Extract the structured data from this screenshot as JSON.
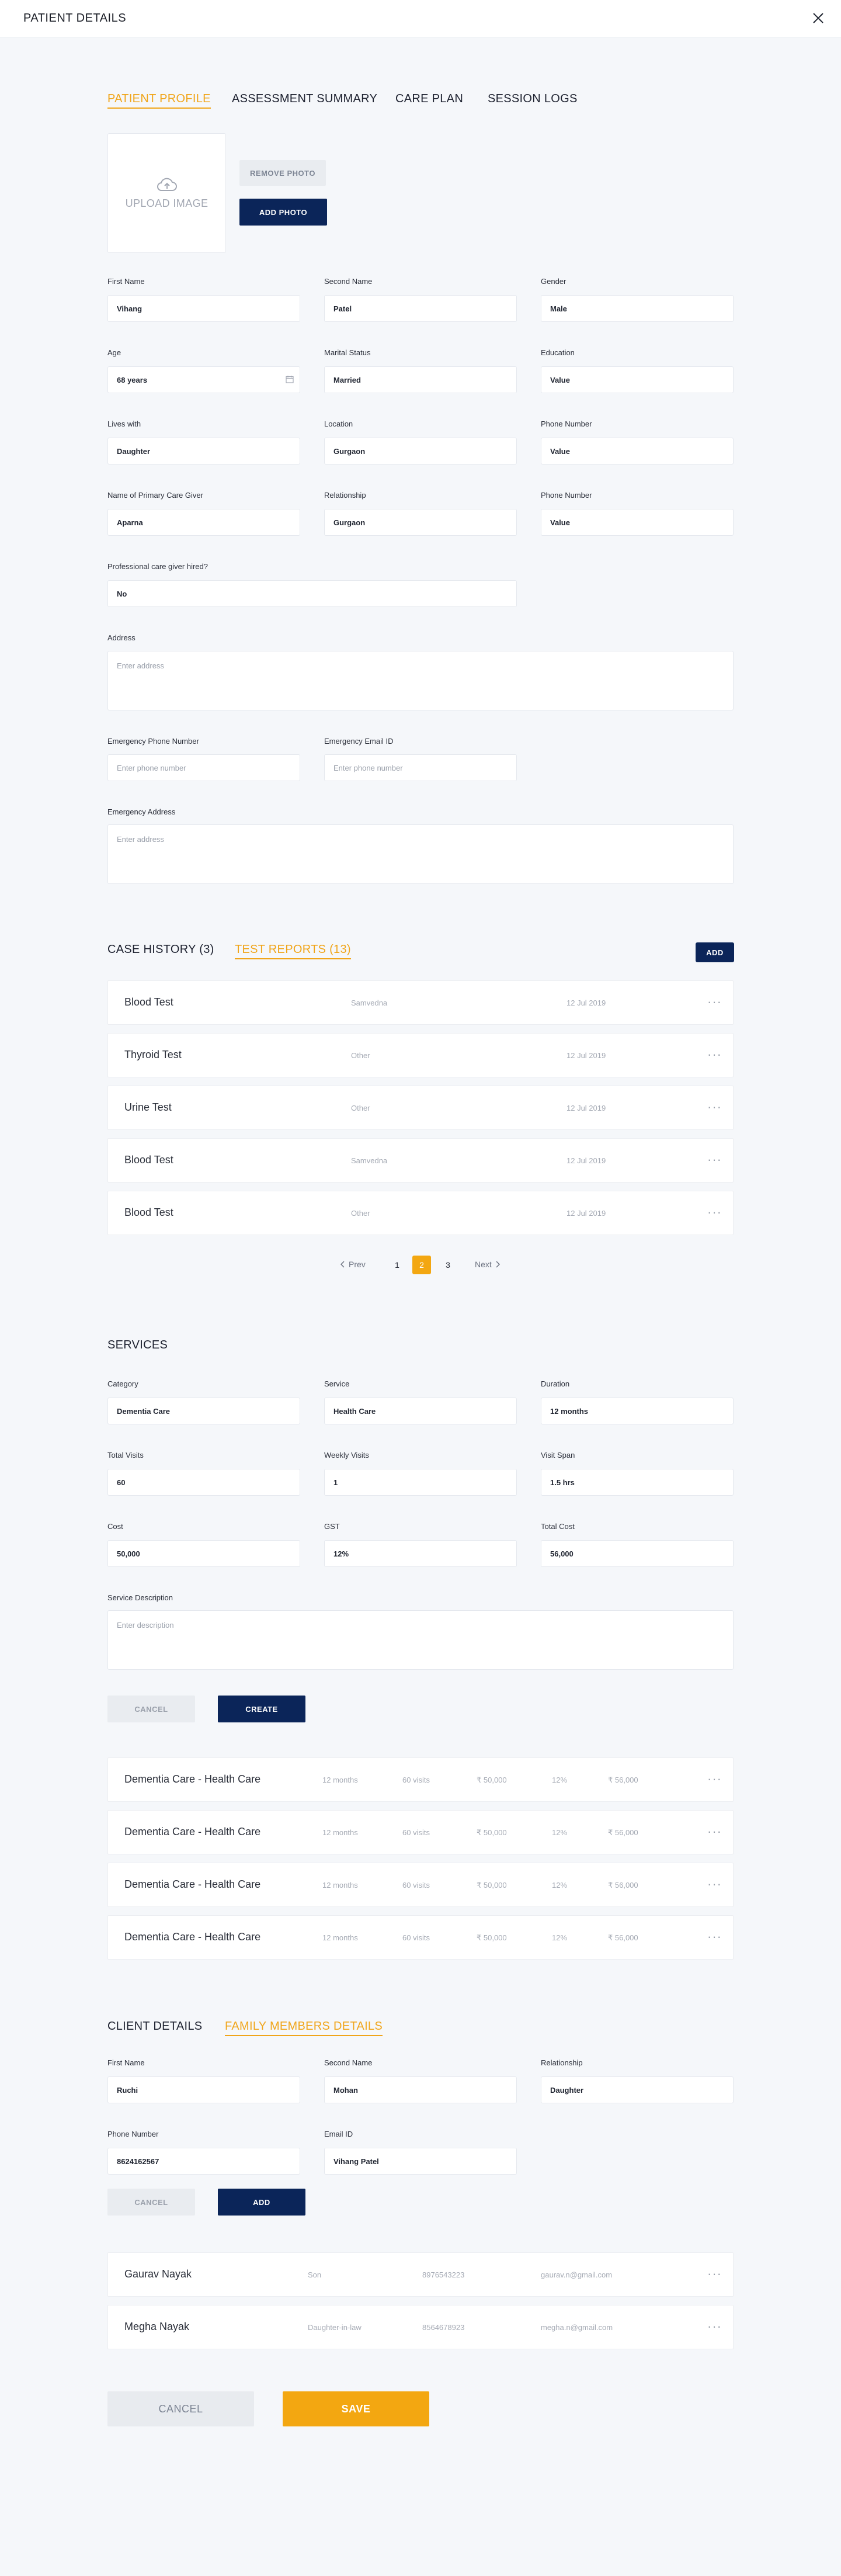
{
  "header": {
    "title": "PATIENT DETAILS"
  },
  "profile_tabs": [
    "PATIENT PROFILE",
    "ASSESSMENT SUMMARY",
    "CARE PLAN",
    "SESSION LOGS"
  ],
  "photo": {
    "upload_label": "UPLOAD IMAGE",
    "remove_label": "REMOVE PHOTO",
    "add_label": "ADD PHOTO"
  },
  "patient": {
    "first_name": {
      "label": "First Name",
      "value": "Vihang"
    },
    "second_name": {
      "label": "Second Name",
      "value": "Patel"
    },
    "gender": {
      "label": "Gender",
      "value": "Male"
    },
    "age": {
      "label": "Age",
      "value": "68 years"
    },
    "marital_status": {
      "label": "Marital Status",
      "value": "Married"
    },
    "education": {
      "label": "Education",
      "value": "Value"
    },
    "lives_with": {
      "label": "Lives with",
      "value": "Daughter"
    },
    "location": {
      "label": "Location",
      "value": "Gurgaon"
    },
    "phone": {
      "label": "Phone Number",
      "value": "Value"
    },
    "primary_caregiver": {
      "label": "Name of Primary Care Giver",
      "value": "Aparna"
    },
    "relationship": {
      "label": "Relationship",
      "value": "Gurgaon"
    },
    "caregiver_phone": {
      "label": "Phone Number",
      "value": "Value"
    },
    "professional_caregiver": {
      "label": "Professional care giver hired?",
      "value": "No"
    },
    "address": {
      "label": "Address",
      "placeholder": "Enter address"
    },
    "emergency_phone": {
      "label": "Emergency Phone Number",
      "placeholder": "Enter phone number"
    },
    "emergency_email": {
      "label": "Emergency Email ID",
      "placeholder": "Enter phone number"
    },
    "emergency_address": {
      "label": "Emergency Address",
      "placeholder": "Enter address"
    }
  },
  "case_tabs": [
    "CASE HISTORY (3)",
    "TEST REPORTS (13)"
  ],
  "case_add_label": "ADD",
  "test_reports": [
    {
      "name": "Blood Test",
      "source": "Samvedna",
      "date": "12 Jul 2019"
    },
    {
      "name": "Thyroid Test",
      "source": "Other",
      "date": "12 Jul 2019"
    },
    {
      "name": "Urine Test",
      "source": "Other",
      "date": "12 Jul 2019"
    },
    {
      "name": "Blood Test",
      "source": "Samvedna",
      "date": "12 Jul 2019"
    },
    {
      "name": "Blood Test",
      "source": "Other",
      "date": "12 Jul 2019"
    }
  ],
  "more_glyph": "···",
  "pagination": {
    "prev": "Prev",
    "next": "Next",
    "pages": [
      "1",
      "2",
      "3"
    ],
    "current": "2"
  },
  "services": {
    "title": "SERVICES",
    "category": {
      "label": "Category",
      "value": "Dementia Care"
    },
    "service": {
      "label": "Service",
      "value": "Health Care"
    },
    "duration": {
      "label": "Duration",
      "value": "12 months"
    },
    "total_visits": {
      "label": "Total Visits",
      "value": "60"
    },
    "weekly_visits": {
      "label": "Weekly Visits",
      "value": "1"
    },
    "visit_span": {
      "label": "Visit Span",
      "value": "1.5 hrs"
    },
    "cost": {
      "label": "Cost",
      "value": "50,000"
    },
    "gst": {
      "label": "GST",
      "value": "12%"
    },
    "total_cost": {
      "label": "Total Cost",
      "value": "56,000"
    },
    "description": {
      "label": "Service Description",
      "placeholder": "Enter description"
    },
    "cancel_label": "CANCEL",
    "create_label": "CREATE",
    "list": [
      {
        "name": "Dementia Care - Health Care",
        "duration": "12 months",
        "visits": "60 visits",
        "cost": "₹ 50,000",
        "gst": "12%",
        "total": "₹ 56,000"
      },
      {
        "name": "Dementia Care - Health Care",
        "duration": "12 months",
        "visits": "60 visits",
        "cost": "₹ 50,000",
        "gst": "12%",
        "total": "₹ 56,000"
      },
      {
        "name": "Dementia Care - Health Care",
        "duration": "12 months",
        "visits": "60 visits",
        "cost": "₹ 50,000",
        "gst": "12%",
        "total": "₹ 56,000"
      },
      {
        "name": "Dementia Care - Health Care",
        "duration": "12 months",
        "visits": "60 visits",
        "cost": "₹ 50,000",
        "gst": "12%",
        "total": "₹ 56,000"
      }
    ]
  },
  "client_tabs": [
    "CLIENT DETAILS",
    "FAMILY MEMBERS DETAILS"
  ],
  "family": {
    "first_name": {
      "label": "First Name",
      "value": "Ruchi"
    },
    "second_name": {
      "label": "Second Name",
      "value": "Mohan"
    },
    "relationship": {
      "label": "Relationship",
      "value": "Daughter"
    },
    "phone": {
      "label": "Phone Number",
      "value": "8624162567"
    },
    "email": {
      "label": "Email ID",
      "value": "Vihang Patel"
    },
    "cancel_label": "CANCEL",
    "add_label": "ADD",
    "members": [
      {
        "name": "Gaurav Nayak",
        "relation": "Son",
        "phone": "8976543223",
        "email": "gaurav.n@gmail.com"
      },
      {
        "name": "Megha Nayak",
        "relation": "Daughter-in-law",
        "phone": "8564678923",
        "email": "megha.n@gmail.com"
      }
    ]
  },
  "footer": {
    "cancel_label": "CANCEL",
    "save_label": "SAVE"
  },
  "colors": {
    "accent": "#f3a711",
    "navy": "#0b2559",
    "background": "#f5f7fa"
  },
  "icons": {
    "close": "close-icon",
    "upload": "cloud-upload-icon",
    "calendar": "calendar-icon",
    "more": "more-icon",
    "prev": "chevron-left-icon",
    "next": "chevron-right-icon"
  }
}
